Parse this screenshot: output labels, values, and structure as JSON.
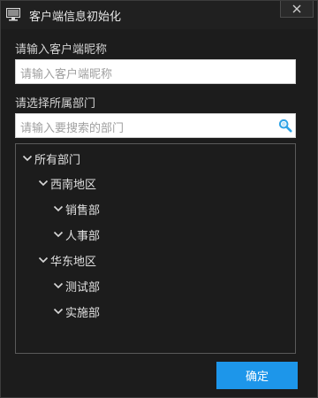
{
  "window": {
    "title": "客户端信息初始化"
  },
  "nickname": {
    "label": "请输入客户端昵称",
    "placeholder": "请输入客户端昵称"
  },
  "department": {
    "label": "请选择所属部门",
    "search_placeholder": "请输入要搜索的部门"
  },
  "tree": {
    "root": "所有部门",
    "region_1": "西南地区",
    "region_1_child_1": "销售部",
    "region_1_child_2": "人事部",
    "region_2": "华东地区",
    "region_2_child_1": "测试部",
    "region_2_child_2": "实施部"
  },
  "footer": {
    "confirm_label": "确定"
  },
  "colors": {
    "accent": "#1d96ea",
    "background": "#1c1c1c",
    "search_icon": "#2fa3e6"
  }
}
